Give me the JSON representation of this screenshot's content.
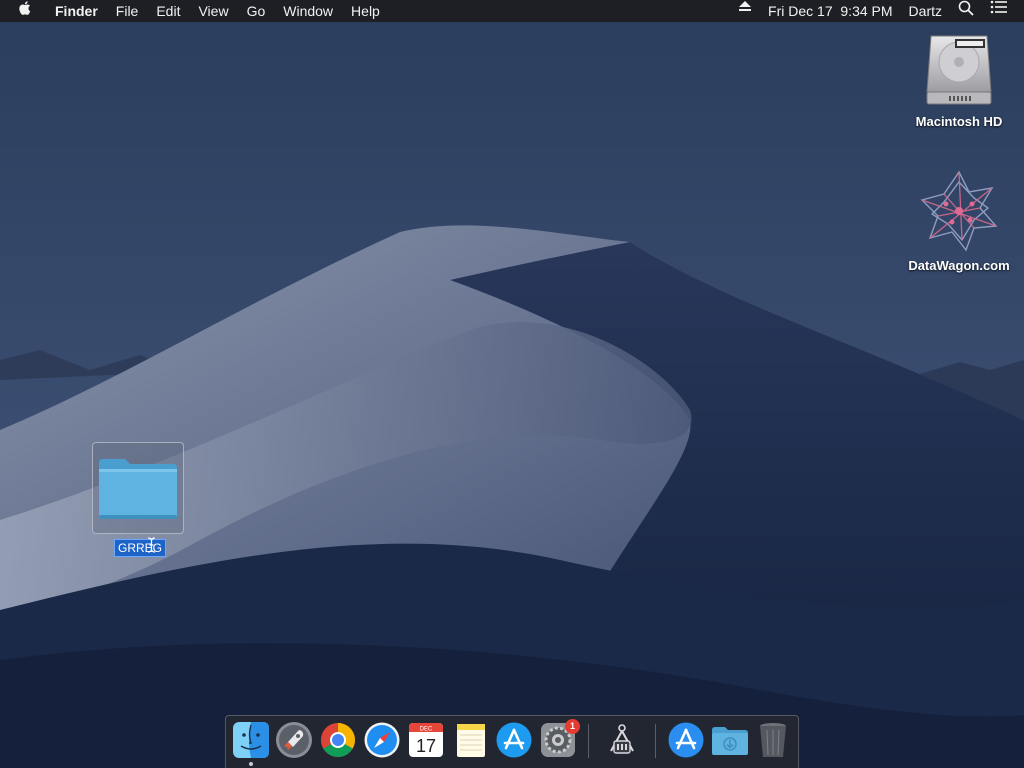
{
  "menubar": {
    "app_name": "Finder",
    "menus": [
      "File",
      "Edit",
      "View",
      "Go",
      "Window",
      "Help"
    ],
    "clock": "Fri Dec 17  9:34 PM",
    "user": "Dartz"
  },
  "desktop": {
    "icons": [
      {
        "label": "Macintosh HD",
        "icon": "hard-drive-icon"
      },
      {
        "label": "DataWagon.com",
        "icon": "network-volume-icon"
      }
    ],
    "folder": {
      "name": "GRREG",
      "state": "renaming",
      "icon": "folder-icon"
    }
  },
  "dock": {
    "apps": [
      {
        "name": "Finder",
        "icon": "finder-icon",
        "running": true
      },
      {
        "name": "Launchpad",
        "icon": "launchpad-icon"
      },
      {
        "name": "Google Chrome",
        "icon": "chrome-icon"
      },
      {
        "name": "Safari",
        "icon": "safari-icon"
      },
      {
        "name": "Calendar",
        "icon": "calendar-icon",
        "month": "DEC",
        "day": "17"
      },
      {
        "name": "Notes",
        "icon": "notes-icon"
      },
      {
        "name": "App Store",
        "icon": "app-store-icon"
      },
      {
        "name": "System Preferences",
        "icon": "system-preferences-icon",
        "badge": "1"
      },
      {
        "name": "Network Utility",
        "icon": "network-utility-icon"
      },
      {
        "name": "App Store",
        "icon": "app-store-icon"
      },
      {
        "name": "Downloads",
        "icon": "downloads-folder-icon"
      },
      {
        "name": "Trash",
        "icon": "trash-icon"
      }
    ]
  },
  "colors": {
    "menubar": "#1c1c20",
    "selection": "#1d63c8",
    "folder": "#5fb3e0",
    "badge": "#e53b30"
  }
}
